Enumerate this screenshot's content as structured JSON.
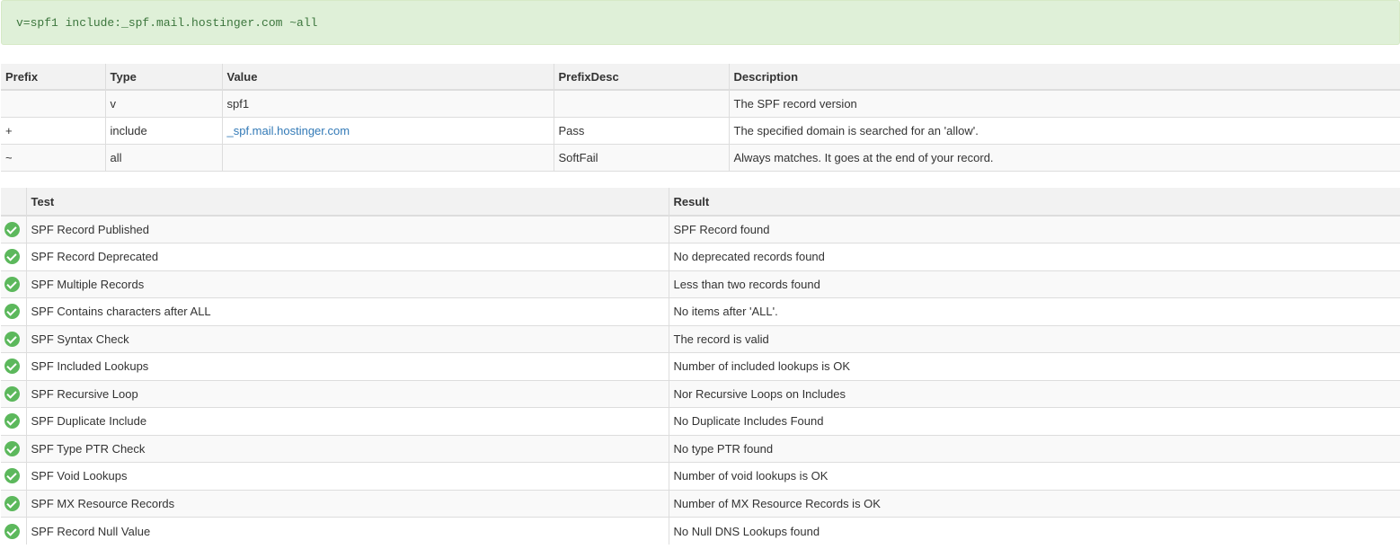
{
  "record": "v=spf1 include:_spf.mail.hostinger.com ~all",
  "tags_table": {
    "headers": {
      "prefix": "Prefix",
      "type": "Type",
      "value": "Value",
      "prefix_desc": "PrefixDesc",
      "description": "Description"
    },
    "rows": [
      {
        "prefix": "",
        "type": "v",
        "value": "spf1",
        "prefix_desc": "",
        "description": "The SPF record version"
      },
      {
        "prefix": "+",
        "type": "include",
        "value": "_spf.mail.hostinger.com",
        "prefix_desc": "Pass",
        "description": "The specified domain is searched for an 'allow'."
      },
      {
        "prefix": "~",
        "type": "all",
        "value": "",
        "prefix_desc": "SoftFail",
        "description": "Always matches. It goes at the end of your record."
      }
    ]
  },
  "tests_table": {
    "headers": {
      "test": "Test",
      "result": "Result"
    },
    "status_icon": "check-circle-icon",
    "status_color": "#5cb85c",
    "rows": [
      {
        "test": "SPF Record Published",
        "result": "SPF Record found"
      },
      {
        "test": "SPF Record Deprecated",
        "result": "No deprecated records found"
      },
      {
        "test": "SPF Multiple Records",
        "result": "Less than two records found"
      },
      {
        "test": "SPF Contains characters after ALL",
        "result": "No items after 'ALL'."
      },
      {
        "test": "SPF Syntax Check",
        "result": "The record is valid"
      },
      {
        "test": "SPF Included Lookups",
        "result": "Number of included lookups is OK"
      },
      {
        "test": "SPF Recursive Loop",
        "result": "Nor Recursive Loops on Includes"
      },
      {
        "test": "SPF Duplicate Include",
        "result": "No Duplicate Includes Found"
      },
      {
        "test": "SPF Type PTR Check",
        "result": "No type PTR found"
      },
      {
        "test": "SPF Void Lookups",
        "result": "Number of void lookups is OK"
      },
      {
        "test": "SPF MX Resource Records",
        "result": "Number of MX Resource Records is OK"
      },
      {
        "test": "SPF Record Null Value",
        "result": "No Null DNS Lookups found"
      }
    ]
  }
}
